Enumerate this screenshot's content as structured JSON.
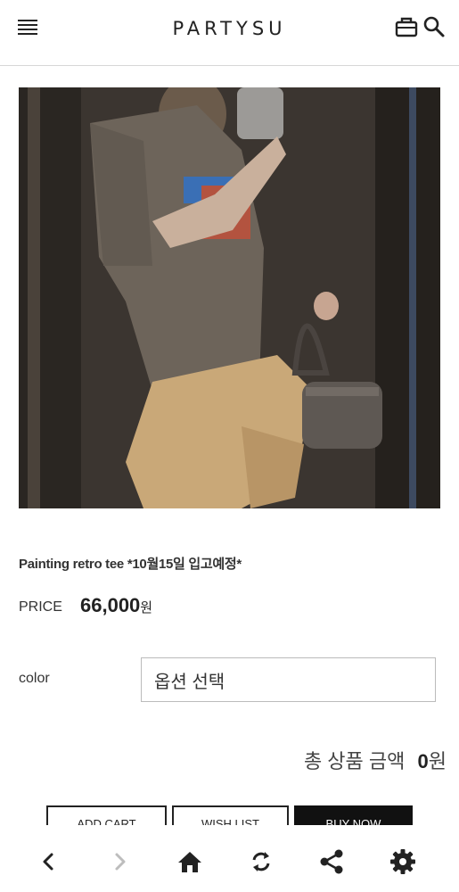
{
  "header": {
    "logo": "PARTYSU",
    "icons": [
      "menu-icon",
      "shopping-bag-icon",
      "search-icon"
    ]
  },
  "product": {
    "name": "Painting retro tee *10월15일 입고예정*",
    "price_label": "PRICE",
    "price_value": "66,000",
    "price_unit": "원"
  },
  "options": {
    "color_label": "color",
    "color_selected": "옵션 선택"
  },
  "total": {
    "label": "총 상품 금액",
    "value": "0",
    "unit": "원"
  },
  "actions": {
    "add_cart": "ADD CART",
    "wish_list": "WISH LIST",
    "buy_now": "BUY NOW"
  },
  "browser_bar": {
    "icons": [
      "back-icon",
      "forward-icon",
      "home-icon",
      "refresh-icon",
      "share-icon",
      "settings-icon"
    ]
  },
  "colors": {
    "text": "#222222",
    "divider": "#d6d6d6",
    "buy_button": "#111111",
    "disabled_icon": "#bdbdbd"
  }
}
